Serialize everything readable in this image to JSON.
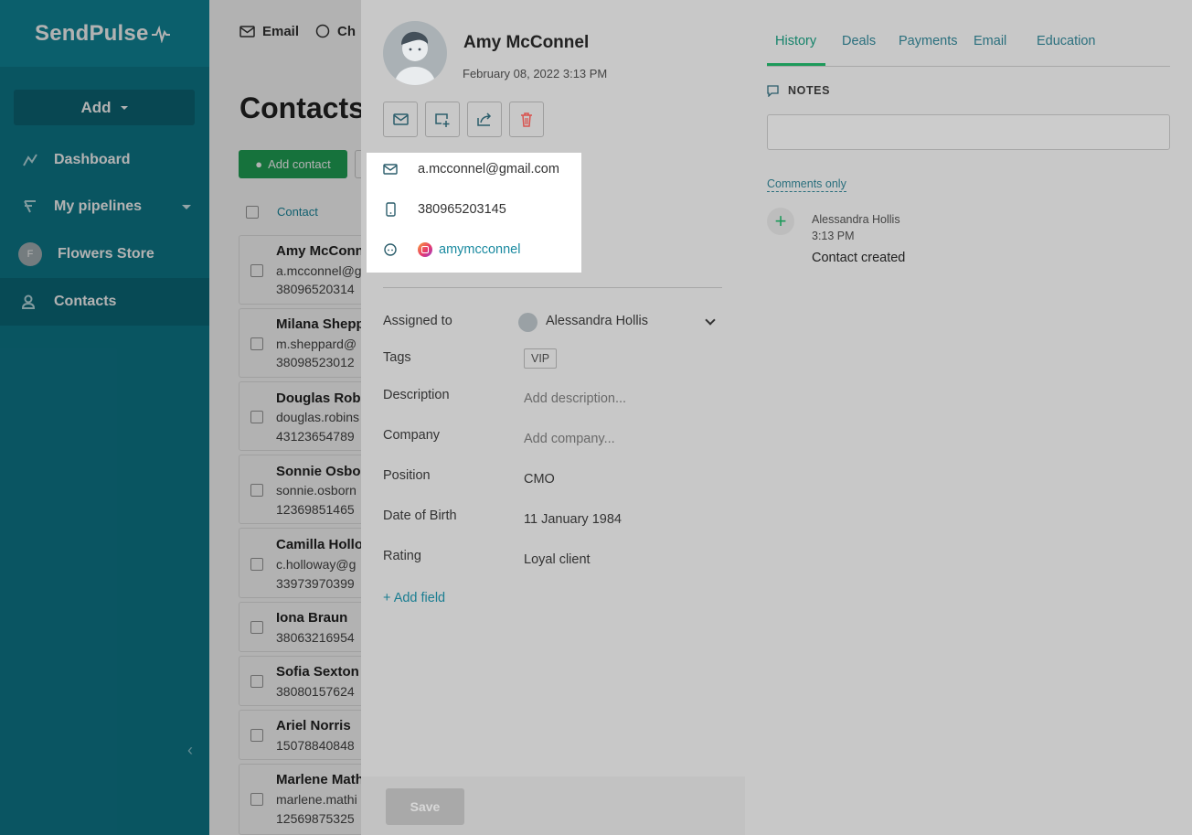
{
  "sidebar": {
    "logo": "SendPulse",
    "add_label": "Add",
    "items": [
      {
        "label": "Dashboard",
        "icon": "dashboard-icon"
      },
      {
        "label": "My pipelines",
        "icon": "pipelines-icon"
      },
      {
        "label": "Flowers Store",
        "icon": "store-avatar",
        "avatar_letter": "F"
      },
      {
        "label": "Contacts",
        "icon": "contacts-icon"
      }
    ]
  },
  "topbar": {
    "email": "Email",
    "chat": "Ch"
  },
  "page": {
    "title": "Contacts",
    "add_contact": "Add contact",
    "column_contact": "Contact"
  },
  "list": [
    {
      "name": "Amy McConn",
      "line1": "a.mcconnel@g",
      "line2": "38096520314"
    },
    {
      "name": "Milana Shepp",
      "line1": "m.sheppard@",
      "line2": "38098523012"
    },
    {
      "name": "Douglas Robi",
      "line1": "douglas.robins",
      "line2": "43123654789"
    },
    {
      "name": "Sonnie Osbor",
      "line1": "sonnie.osborn",
      "line2": "12369851465"
    },
    {
      "name": "Camilla Hollo",
      "line1": "c.holloway@g",
      "line2": "33973970399"
    },
    {
      "name": "Iona Braun",
      "line1": "38063216954"
    },
    {
      "name": "Sofia Sexton",
      "line1": "38080157624"
    },
    {
      "name": "Ariel Norris",
      "line1": "15078840848"
    },
    {
      "name": "Marlene Math",
      "line1": "marlene.mathi",
      "line2": "12569875325"
    }
  ],
  "contact": {
    "name": "Amy McConnel",
    "created": "February 08, 2022 3:13 PM",
    "email": "a.mcconnel@gmail.com",
    "phone": "380965203145",
    "instagram": "amymcconnel",
    "fields": {
      "assigned_to_label": "Assigned to",
      "assigned_to": "Alessandra Hollis",
      "tags_label": "Tags",
      "tag": "VIP",
      "description_label": "Description",
      "description_placeholder": "Add description...",
      "company_label": "Company",
      "company_placeholder": "Add company...",
      "position_label": "Position",
      "position": "CMO",
      "dob_label": "Date of Birth",
      "dob": "11 January 1984",
      "rating_label": "Rating",
      "rating": "Loyal client"
    },
    "add_field": "+ Add field",
    "save": "Save"
  },
  "right": {
    "tabs": [
      "History",
      "Deals",
      "Payments",
      "Email",
      "Education"
    ],
    "notes_title": "NOTES",
    "comments_only": "Comments only",
    "history": {
      "author": "Alessandra Hollis",
      "time": "3:13 PM",
      "text": "Contact created"
    }
  },
  "colors": {
    "sidebar": "#0e7a8c",
    "accent_green": "#20a457",
    "link": "#1a8aa0",
    "delete": "#d9534f"
  }
}
